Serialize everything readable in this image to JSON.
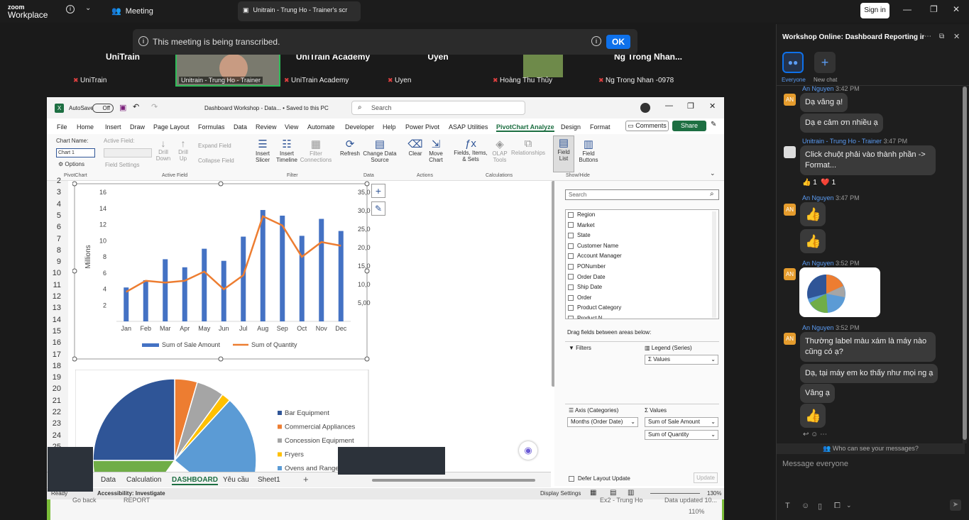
{
  "top_bar": {
    "logo_line1": "zoom",
    "logo_line2": "Workplace",
    "meeting_tab": "Meeting",
    "share_tab": "Unitrain - Trung Ho - Trainer's scr",
    "sign_in": "Sign in",
    "info_icon": "info-icon",
    "chevron_icon": "chevron-down-icon"
  },
  "notice": {
    "text": "This meeting is being transcribed.",
    "ok": "OK"
  },
  "participants": [
    {
      "name": "UniTrain",
      "label": "UniTrain"
    },
    {
      "name": "",
      "label": "Unitrain - Trung Ho - Trainer"
    },
    {
      "name": "UniTrain Academy",
      "label": "UniTrain Academy"
    },
    {
      "name": "Uyen",
      "label": "Uyen"
    },
    {
      "name": "",
      "label": "Hoàng Thu Thủy"
    },
    {
      "name": "Ng Trong Nhan...",
      "label": "Ng Trong Nhan -0978"
    }
  ],
  "excel": {
    "autosave": "AutoSave",
    "autosave_state": "Off",
    "file_title": "Dashboard Workshop - Data... • Saved to this PC",
    "search_placeholder": "Search",
    "menu": [
      "File",
      "Home",
      "Insert",
      "Draw",
      "Page Layout",
      "Formulas",
      "Data",
      "Review",
      "View",
      "Automate",
      "Developer",
      "Help",
      "Power Pivot",
      "ASAP Utilities",
      "PivotChart Analyze",
      "Design",
      "Format"
    ],
    "active_menu": "PivotChart Analyze",
    "comments": "Comments",
    "share": "Share",
    "ribbon": {
      "chart_name_label": "Chart Name:",
      "chart_name_value": "Chart 1",
      "options": "Options",
      "pivotchart_group": "PivotChart",
      "active_field_label": "Active Field:",
      "field_settings": "Field Settings",
      "drill_down": "Drill Down",
      "drill_up": "Drill Up",
      "expand_field": "Expand Field",
      "collapse_field": "Collapse Field",
      "active_field_group": "Active Field",
      "insert_slicer": "Insert Slicer",
      "insert_timeline": "Insert Timeline",
      "filter_connections": "Filter Connections",
      "filter_group": "Filter",
      "refresh": "Refresh",
      "change_data_source": "Change Data Source",
      "data_group": "Data",
      "clear": "Clear",
      "move_chart": "Move Chart",
      "actions_group": "Actions",
      "fields_items_sets": "Fields, Items, & Sets",
      "olap_tools": "OLAP Tools",
      "relationships": "Relationships",
      "calculations_group": "Calculations",
      "field_list": "Field List",
      "field_buttons": "Field Buttons",
      "show_hide_group": "Show/Hide"
    },
    "row_numbers": [
      "2",
      "3",
      "4",
      "5",
      "6",
      "7",
      "8",
      "9",
      "10",
      "11",
      "12",
      "13",
      "14",
      "15",
      "16",
      "17",
      "18",
      "19",
      "20",
      "21",
      "22",
      "23",
      "24",
      "25"
    ],
    "sheet_tabs": [
      "Data",
      "Calculation",
      "DASHBOARD",
      "Yêu cầu",
      "Sheet1"
    ],
    "active_sheet": "DASHBOARD",
    "status_ready": "Ready",
    "status_accessibility": "Accessibility: Investigate",
    "display_settings": "Display Settings",
    "zoom": "130%",
    "field_pane": {
      "search_placeholder": "Search",
      "fields": [
        "Region",
        "Market",
        "State",
        "Customer Name",
        "Account Manager",
        "PONumber",
        "Order Date",
        "Ship Date",
        "Order",
        "Product Category",
        "Product N..."
      ],
      "drag_text": "Drag fields between areas below:",
      "filters": "Filters",
      "legend": "Legend (Series)",
      "legend_item": "Values",
      "axis": "Axis (Categories)",
      "axis_item": "Months (Order Date)",
      "values": "Values",
      "values_items": [
        "Sum of Sale Amount",
        "Sum of Quantity"
      ],
      "defer": "Defer Layout Update",
      "update": "Update"
    },
    "behind_status": {
      "go_back": "Go back",
      "report": "REPORT",
      "user": "Ex2 - Trung Ho",
      "data_updated": "Data updated 10...",
      "zoom": "110%"
    }
  },
  "chart_data": [
    {
      "type": "bar",
      "categories": [
        "Jan",
        "Feb",
        "Mar",
        "Apr",
        "May",
        "Jun",
        "Jul",
        "Aug",
        "Sep",
        "Oct",
        "Nov",
        "Dec"
      ],
      "series": [
        {
          "name": "Sum of Sale Amount",
          "type": "bar",
          "axis": "left",
          "values": [
            4.2,
            5.1,
            7.7,
            6.7,
            9.0,
            7.5,
            10.5,
            13.8,
            13.1,
            10.6,
            12.7,
            11.2
          ]
        },
        {
          "name": "Sum of Quantity",
          "type": "line",
          "axis": "right",
          "values": [
            8000,
            11000,
            10500,
            11000,
            13500,
            8700,
            12500,
            28500,
            26000,
            17500,
            21500,
            20500
          ]
        }
      ],
      "ylabel": "Millions",
      "ylim": [
        0,
        16
      ],
      "yticks": [
        2,
        4,
        6,
        8,
        10,
        12,
        14,
        16
      ],
      "y2lim": [
        0,
        35000
      ],
      "y2ticks": [
        "5,000",
        "10,000",
        "15,000",
        "20,000",
        "25,000",
        "30,000",
        "35,000"
      ],
      "legend": "bottom",
      "colors": {
        "bars": "#4472c4",
        "line": "#ed7d31"
      }
    },
    {
      "type": "pie",
      "labels": [
        "Bar Equipment",
        "Commercial Appliances",
        "Concession Equipment",
        "Fryers",
        "Ovens and Ranges"
      ],
      "legend": "right",
      "colors": [
        "#2f5597",
        "#ed7d31",
        "#a5a5a5",
        "#ffc000",
        "#5b9bd5",
        "#70ad47"
      ]
    }
  ],
  "chat": {
    "title": "Workshop Online: Dashboard Reporting in...",
    "everyone": "Everyone",
    "new_chat": "New chat",
    "messages": [
      {
        "sender": "An Nguyen",
        "time": "3:42 PM",
        "lines": [
          "Dạ vâng ạ!",
          "Dạ e cảm ơn nhiều ạ"
        ]
      },
      {
        "sender": "Unitrain - Trung Ho - Trainer",
        "time": "3:47 PM",
        "lines": [
          "Click chuột phải vào thành phần -> Format..."
        ],
        "reactions": [
          "👍 1",
          "❤️ 1"
        ]
      },
      {
        "sender": "An Nguyen",
        "time": "3:47 PM",
        "lines": [
          "👍",
          "👍"
        ]
      },
      {
        "sender": "An Nguyen",
        "time": "3:52 PM",
        "image": true
      },
      {
        "sender": "An Nguyen",
        "time": "3:52 PM",
        "lines": [
          "Thường label màu xám là máy nào cũng có ạ?",
          "Dạ, tại máy em ko thấy như mọi ng ạ",
          "Vâng ạ",
          "👍"
        ]
      }
    ],
    "who_can_see": "Who can see your messages?",
    "input_placeholder": "Message everyone"
  }
}
